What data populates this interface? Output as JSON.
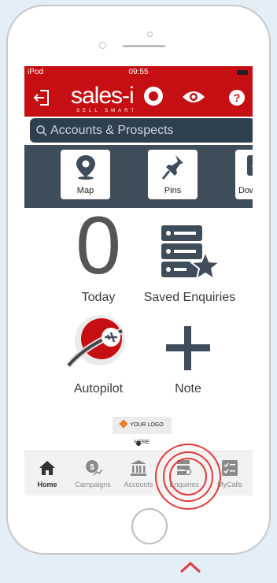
{
  "status_bar": {
    "carrier": "iPod",
    "time": "09:55"
  },
  "app_bar": {
    "brand": "sales-i",
    "tagline": "SELL SMART"
  },
  "search": {
    "placeholder": "Accounts & Prospects"
  },
  "shortcuts": [
    {
      "label": "Map",
      "icon": "map-pin-icon"
    },
    {
      "label": "Pins",
      "icon": "push-pin-icon"
    },
    {
      "label": "Down",
      "icon": "download-icon"
    }
  ],
  "dashboard": {
    "today_count": "0",
    "today_label": "Today",
    "saved_enquiries_label": "Saved Enquiries",
    "autopilot_label": "Autopilot",
    "note_label": "Note"
  },
  "ad": {
    "text": "YOUR LOGO HERE"
  },
  "tabs": [
    {
      "label": "Home",
      "icon": "home-icon",
      "active": true
    },
    {
      "label": "Campaigns",
      "icon": "campaigns-icon"
    },
    {
      "label": "Accounts",
      "icon": "bank-icon"
    },
    {
      "label": "Enquiries",
      "icon": "enquiries-icon",
      "highlighted": true
    },
    {
      "label": "MyCalls",
      "icon": "checklist-icon"
    }
  ],
  "colors": {
    "brand_red": "#c50f12",
    "dark_slate": "#3f4c5a",
    "search_bg": "#2e3f4f",
    "highlight_ring": "#e23b3b"
  }
}
